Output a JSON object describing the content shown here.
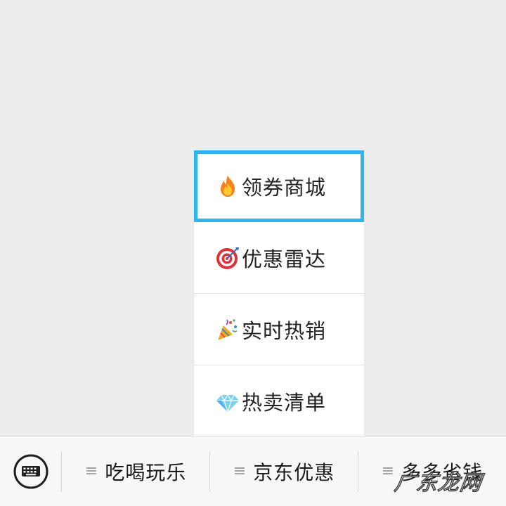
{
  "menu": {
    "items": [
      {
        "icon": "fire-icon",
        "label": "领券商城",
        "selected": true
      },
      {
        "icon": "target-icon",
        "label": "优惠雷达",
        "selected": false
      },
      {
        "icon": "party-popper-icon",
        "label": "实时热销",
        "selected": false
      },
      {
        "icon": "diamond-icon",
        "label": "热卖清单",
        "selected": false
      }
    ],
    "highlight_color": "#2fb4ee"
  },
  "bottom_bar": {
    "keyboard_icon": "keyboard-icon",
    "tabs": [
      {
        "label": "吃喝玩乐"
      },
      {
        "label": "京东优惠"
      },
      {
        "label": "多多省钱"
      }
    ]
  },
  "watermark": {
    "text": "广东龙网"
  }
}
